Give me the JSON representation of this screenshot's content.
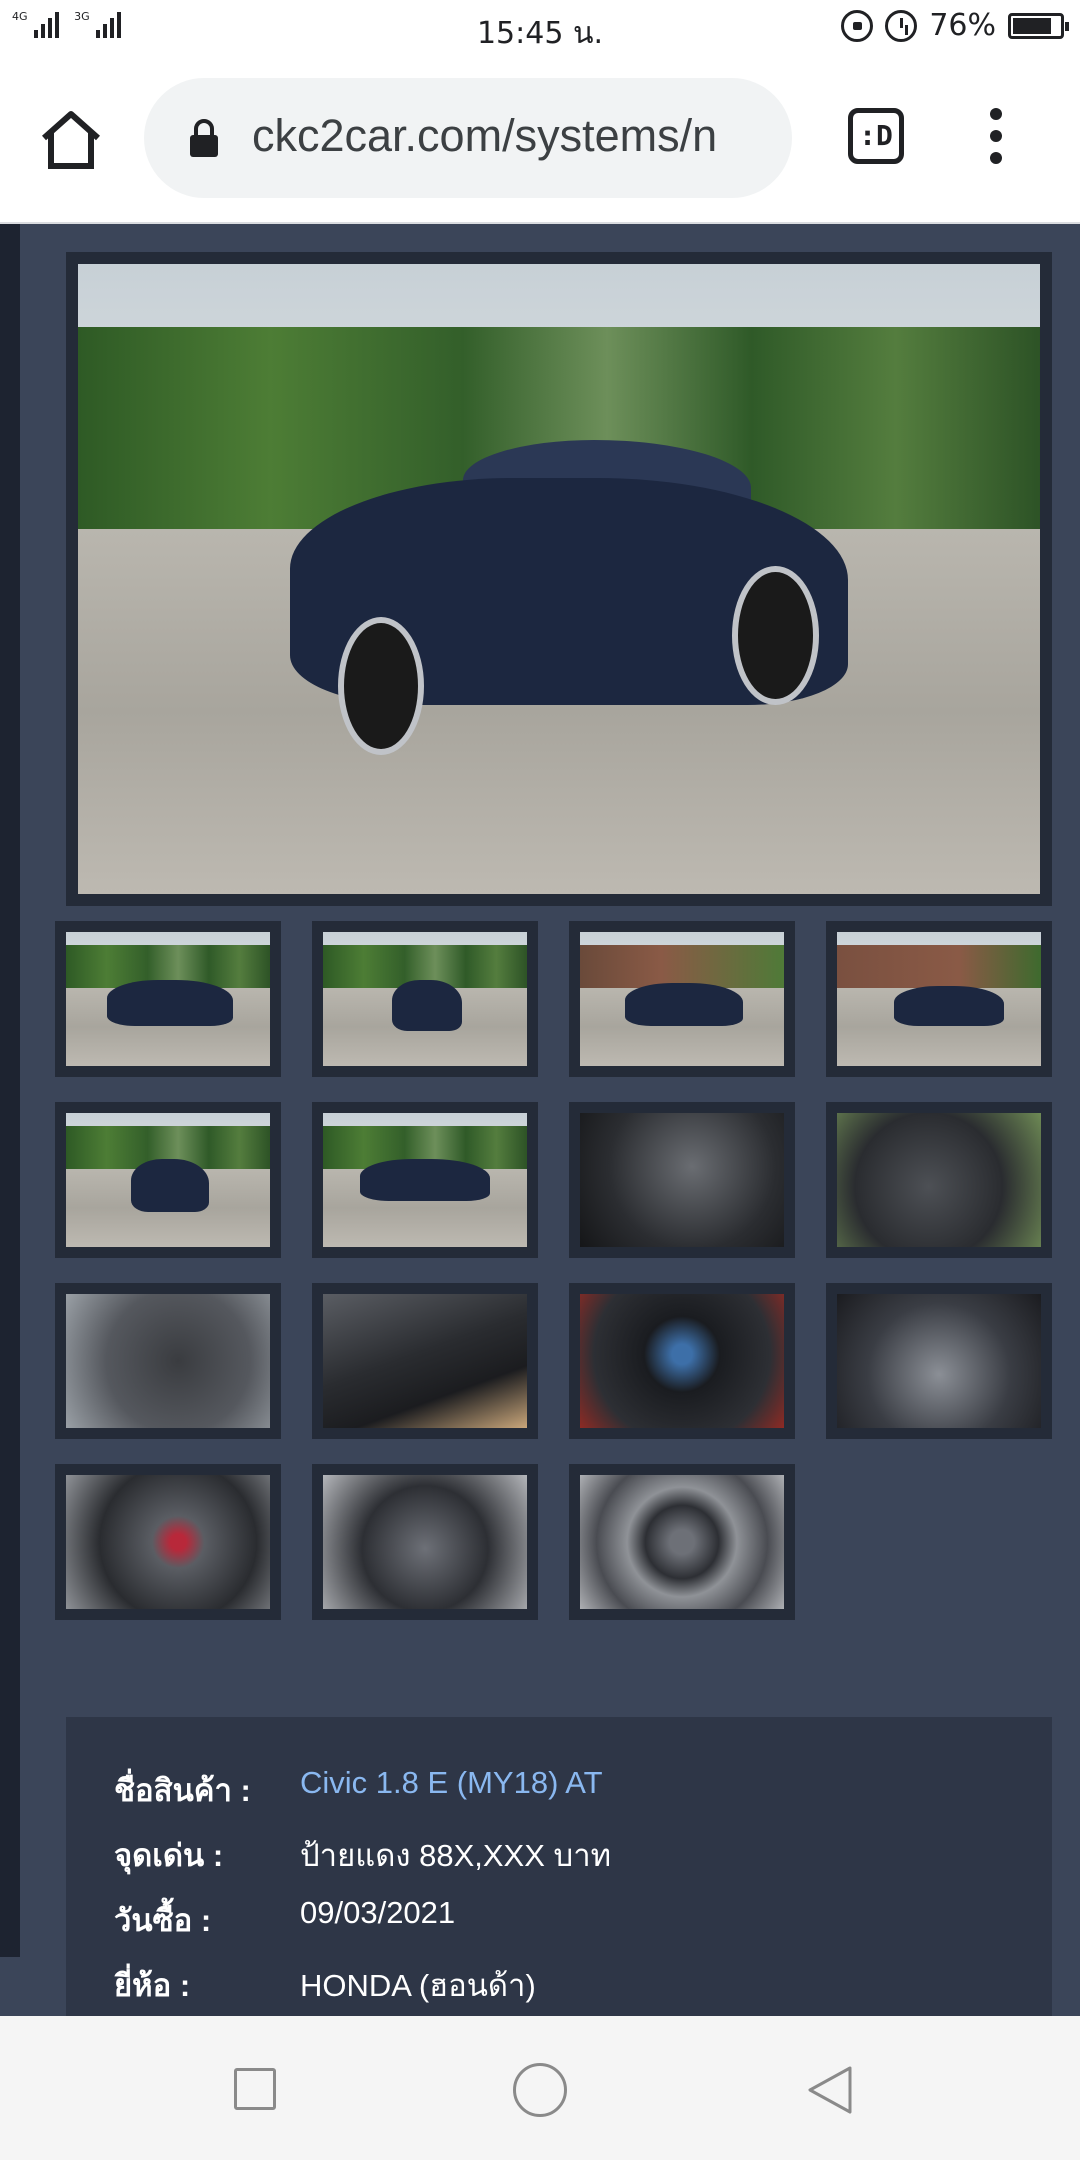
{
  "status_bar": {
    "network_left": "4G",
    "network_right": "3G",
    "time": "15:45 น.",
    "battery_percent": "76%",
    "icons": [
      "signal-icon",
      "rotation-lock-icon",
      "alarm-icon",
      "battery-icon"
    ]
  },
  "browser": {
    "url": "ckc2car.com/systems/n",
    "tab_label": ":D",
    "icons": [
      "home-icon",
      "lock-icon",
      "tab-switcher-icon",
      "more-vert-icon"
    ]
  },
  "gallery": {
    "main_photo": "car-front-photo",
    "thumbnails": [
      "car-front-left",
      "car-front",
      "car-front-right",
      "car-rear-right",
      "car-rear",
      "car-rear-left",
      "dashboard",
      "driver-seat",
      "rear-seat",
      "door-panel",
      "gauge-cluster",
      "engine-bay",
      "engine-detail",
      "engine-top",
      "spare-tire"
    ]
  },
  "details": {
    "rows": [
      {
        "label": "ชื่อสินค้า :",
        "value": "Civic 1.8 E (MY18) AT",
        "link": true
      },
      {
        "label": "จุดเด่น :",
        "value": "ป้ายแดง 88X,XXX บาท",
        "link": false
      },
      {
        "label": "วันซื้อ :",
        "value": "09/03/2021",
        "link": false
      },
      {
        "label": "ยี่ห้อ :",
        "value": "HONDA (ฮอนด้า)",
        "link": false
      }
    ]
  },
  "colors": {
    "page_bg": "#3b4559",
    "frame_bg": "#242b38",
    "info_bg": "#2e3647",
    "link": "#8ab8f0"
  }
}
